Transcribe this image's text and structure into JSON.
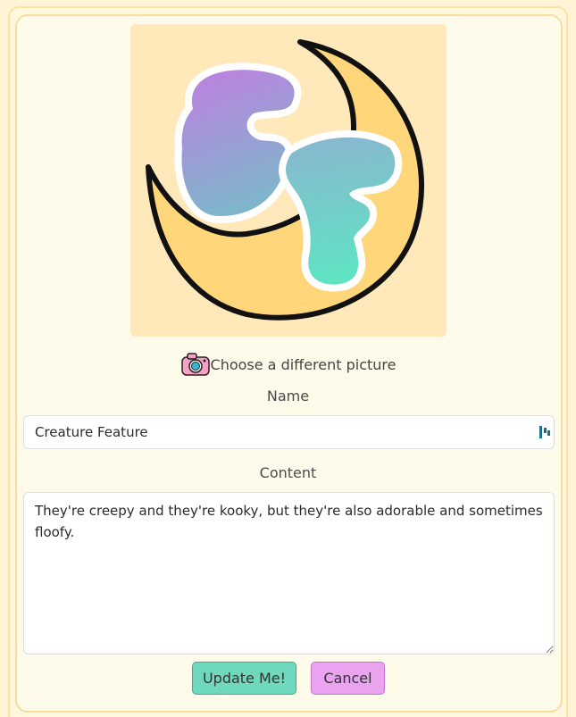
{
  "logo": {
    "icon": "creature-feature-moon-logo",
    "letters": "CF",
    "colors": {
      "background": "#ffe8ba",
      "moon": "#ffd77a",
      "gradient_top": "#c07ee0",
      "gradient_bottom": "#5fe3c3"
    }
  },
  "picture_picker": {
    "icon": "camera-icon",
    "label": "Choose a different picture"
  },
  "form": {
    "name_label": "Name",
    "name_value": "Creature Feature",
    "content_label": "Content",
    "content_value": "They're creepy and they're kooky, but they're also adorable and sometimes floofy."
  },
  "buttons": {
    "update_label": "Update Me!",
    "cancel_label": "Cancel",
    "update_color": "#6fd8bd",
    "cancel_color": "#e9a3ef"
  },
  "theme": {
    "page_bg": "#fff4d6",
    "card_bg": "#fffbea",
    "card_border": "#f8dd9c"
  }
}
